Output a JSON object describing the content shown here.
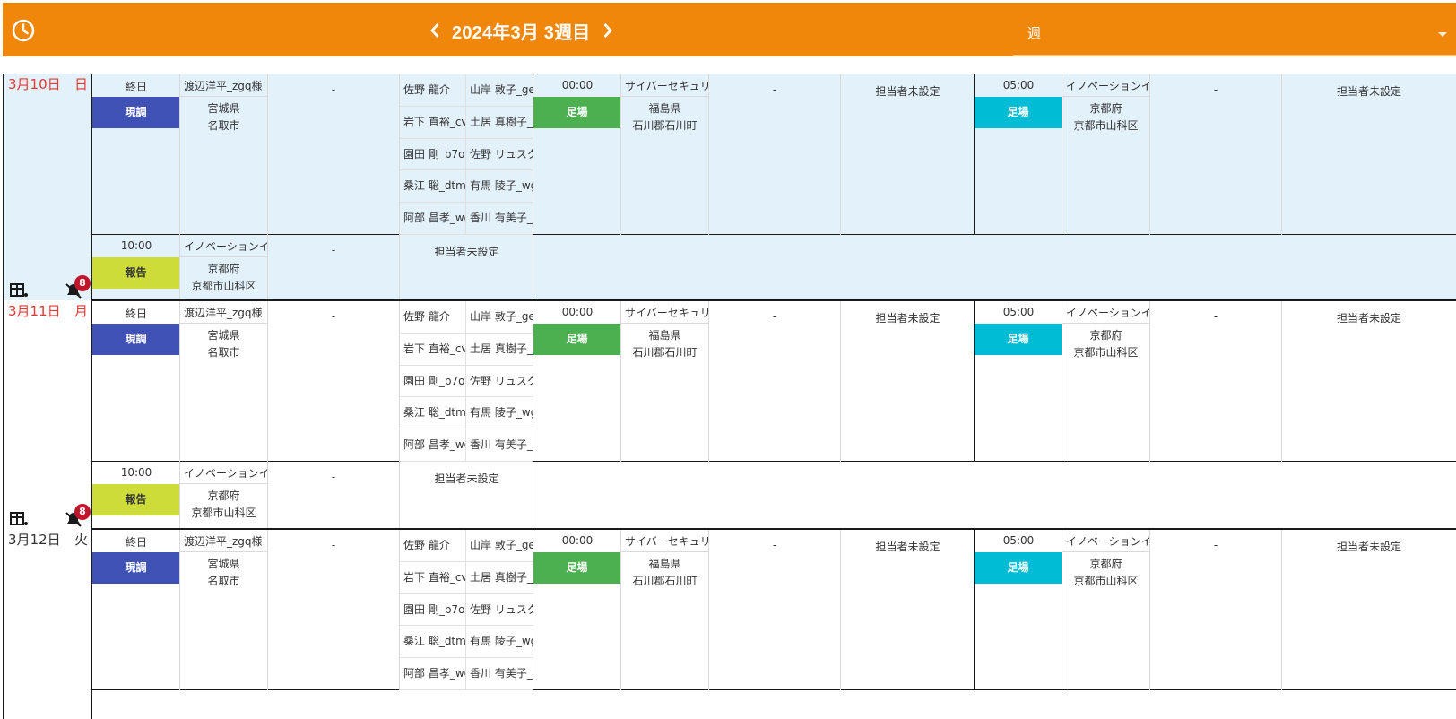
{
  "header": {
    "title": "2024年3月 3週目",
    "view_select_value": "週",
    "accent_color": "#f0870b",
    "icons": [
      "clock-icon",
      "chevron-left-icon",
      "chevron-right-icon",
      "dropdown-caret-icon"
    ]
  },
  "days": [
    {
      "date": "3月10日",
      "dow": "日",
      "highlight": true,
      "red": true,
      "badge": "8",
      "events_row1": [
        {
          "time": "終日",
          "corp": "渡辺洋平_zgq様",
          "tag": "現調",
          "tag_color": "#3f51b5",
          "pref": "宮城県",
          "city": "名取市",
          "dash": "-",
          "staff": [
            "佐野 龍介",
            "山岸 敦子_ge",
            "岩下 直裕_cv",
            "土居 真樹子_",
            "園田 剛_b7o",
            "佐野 リュスク",
            "桑江 聡_dtm",
            "有馬 陵子_wg",
            "阿部 昌孝_wg",
            "香川 有美子_"
          ]
        },
        {
          "time": "00:00",
          "corp": "サイバーセキュリ",
          "tag": "足場",
          "tag_color": "#4caf50",
          "pref": "福島県",
          "city": "石川郡石川町",
          "dash": "-",
          "unset": "担当者未設定"
        },
        {
          "time": "05:00",
          "corp": "イノベーションイ",
          "tag": "足場",
          "tag_color": "#00bcd4",
          "pref": "京都府",
          "city": "京都市山科区",
          "dash": "-",
          "unset": "担当者未設定"
        }
      ],
      "event_row2": {
        "time": "10:00",
        "corp": "イノベーションイ",
        "tag": "報告",
        "tag_color": "#cddc39",
        "pref": "京都府",
        "city": "京都市山科区",
        "dash": "-",
        "unset": "担当者未設定"
      }
    },
    {
      "date": "3月11日",
      "dow": "月",
      "highlight": false,
      "red": true,
      "badge": "8",
      "events_row1": [
        {
          "time": "終日",
          "corp": "渡辺洋平_zgq様",
          "tag": "現調",
          "tag_color": "#3f51b5",
          "pref": "宮城県",
          "city": "名取市",
          "dash": "-",
          "staff": [
            "佐野 龍介",
            "山岸 敦子_ge",
            "岩下 直裕_cv",
            "土居 真樹子_",
            "園田 剛_b7o",
            "佐野 リュスク",
            "桑江 聡_dtm",
            "有馬 陵子_wg",
            "阿部 昌孝_wg",
            "香川 有美子_"
          ]
        },
        {
          "time": "00:00",
          "corp": "サイバーセキュリ",
          "tag": "足場",
          "tag_color": "#4caf50",
          "pref": "福島県",
          "city": "石川郡石川町",
          "dash": "-",
          "unset": "担当者未設定"
        },
        {
          "time": "05:00",
          "corp": "イノベーションイ",
          "tag": "足場",
          "tag_color": "#00bcd4",
          "pref": "京都府",
          "city": "京都市山科区",
          "dash": "-",
          "unset": "担当者未設定"
        }
      ],
      "event_row2": {
        "time": "10:00",
        "corp": "イノベーションイ",
        "tag": "報告",
        "tag_color": "#cddc39",
        "pref": "京都府",
        "city": "京都市山科区",
        "dash": "-",
        "unset": "担当者未設定"
      }
    },
    {
      "date": "3月12日",
      "dow": "火",
      "highlight": false,
      "red": false,
      "events_row1": [
        {
          "time": "終日",
          "corp": "渡辺洋平_zgq様",
          "tag": "現調",
          "tag_color": "#3f51b5",
          "pref": "宮城県",
          "city": "名取市",
          "dash": "-",
          "staff": [
            "佐野 龍介",
            "山岸 敦子_ge",
            "岩下 直裕_cv",
            "土居 真樹子_",
            "園田 剛_b7o",
            "佐野 リュスク",
            "桑江 聡_dtm",
            "有馬 陵子_wg",
            "阿部 昌孝_wg",
            "香川 有美子_"
          ]
        },
        {
          "time": "00:00",
          "corp": "サイバーセキュリ",
          "tag": "足場",
          "tag_color": "#4caf50",
          "pref": "福島県",
          "city": "石川郡石川町",
          "dash": "-",
          "unset": "担当者未設定"
        },
        {
          "time": "05:00",
          "corp": "イノベーションイ",
          "tag": "足場",
          "tag_color": "#00bcd4",
          "pref": "京都府",
          "city": "京都市山科区",
          "dash": "-",
          "unset": "担当者未設定"
        }
      ]
    }
  ]
}
